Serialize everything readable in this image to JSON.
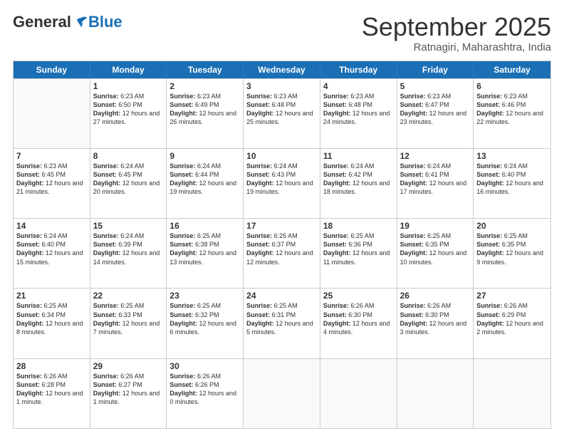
{
  "header": {
    "logo_general": "General",
    "logo_blue": "Blue",
    "month_title": "September 2025",
    "location": "Ratnagiri, Maharashtra, India"
  },
  "weekdays": [
    "Sunday",
    "Monday",
    "Tuesday",
    "Wednesday",
    "Thursday",
    "Friday",
    "Saturday"
  ],
  "rows": [
    [
      {
        "day": "",
        "sunrise": "",
        "sunset": "",
        "daylight": ""
      },
      {
        "day": "1",
        "sunrise": "6:23 AM",
        "sunset": "6:50 PM",
        "daylight": "12 hours and 27 minutes."
      },
      {
        "day": "2",
        "sunrise": "6:23 AM",
        "sunset": "6:49 PM",
        "daylight": "12 hours and 26 minutes."
      },
      {
        "day": "3",
        "sunrise": "6:23 AM",
        "sunset": "6:48 PM",
        "daylight": "12 hours and 25 minutes."
      },
      {
        "day": "4",
        "sunrise": "6:23 AM",
        "sunset": "6:48 PM",
        "daylight": "12 hours and 24 minutes."
      },
      {
        "day": "5",
        "sunrise": "6:23 AM",
        "sunset": "6:47 PM",
        "daylight": "12 hours and 23 minutes."
      },
      {
        "day": "6",
        "sunrise": "6:23 AM",
        "sunset": "6:46 PM",
        "daylight": "12 hours and 22 minutes."
      }
    ],
    [
      {
        "day": "7",
        "sunrise": "6:23 AM",
        "sunset": "6:45 PM",
        "daylight": "12 hours and 21 minutes."
      },
      {
        "day": "8",
        "sunrise": "6:24 AM",
        "sunset": "6:45 PM",
        "daylight": "12 hours and 20 minutes."
      },
      {
        "day": "9",
        "sunrise": "6:24 AM",
        "sunset": "6:44 PM",
        "daylight": "12 hours and 19 minutes."
      },
      {
        "day": "10",
        "sunrise": "6:24 AM",
        "sunset": "6:43 PM",
        "daylight": "12 hours and 19 minutes."
      },
      {
        "day": "11",
        "sunrise": "6:24 AM",
        "sunset": "6:42 PM",
        "daylight": "12 hours and 18 minutes."
      },
      {
        "day": "12",
        "sunrise": "6:24 AM",
        "sunset": "6:41 PM",
        "daylight": "12 hours and 17 minutes."
      },
      {
        "day": "13",
        "sunrise": "6:24 AM",
        "sunset": "6:40 PM",
        "daylight": "12 hours and 16 minutes."
      }
    ],
    [
      {
        "day": "14",
        "sunrise": "6:24 AM",
        "sunset": "6:40 PM",
        "daylight": "12 hours and 15 minutes."
      },
      {
        "day": "15",
        "sunrise": "6:24 AM",
        "sunset": "6:39 PM",
        "daylight": "12 hours and 14 minutes."
      },
      {
        "day": "16",
        "sunrise": "6:25 AM",
        "sunset": "6:38 PM",
        "daylight": "12 hours and 13 minutes."
      },
      {
        "day": "17",
        "sunrise": "6:25 AM",
        "sunset": "6:37 PM",
        "daylight": "12 hours and 12 minutes."
      },
      {
        "day": "18",
        "sunrise": "6:25 AM",
        "sunset": "6:36 PM",
        "daylight": "12 hours and 11 minutes."
      },
      {
        "day": "19",
        "sunrise": "6:25 AM",
        "sunset": "6:35 PM",
        "daylight": "12 hours and 10 minutes."
      },
      {
        "day": "20",
        "sunrise": "6:25 AM",
        "sunset": "6:35 PM",
        "daylight": "12 hours and 9 minutes."
      }
    ],
    [
      {
        "day": "21",
        "sunrise": "6:25 AM",
        "sunset": "6:34 PM",
        "daylight": "12 hours and 8 minutes."
      },
      {
        "day": "22",
        "sunrise": "6:25 AM",
        "sunset": "6:33 PM",
        "daylight": "12 hours and 7 minutes."
      },
      {
        "day": "23",
        "sunrise": "6:25 AM",
        "sunset": "6:32 PM",
        "daylight": "12 hours and 6 minutes."
      },
      {
        "day": "24",
        "sunrise": "6:25 AM",
        "sunset": "6:31 PM",
        "daylight": "12 hours and 5 minutes."
      },
      {
        "day": "25",
        "sunrise": "6:26 AM",
        "sunset": "6:30 PM",
        "daylight": "12 hours and 4 minutes."
      },
      {
        "day": "26",
        "sunrise": "6:26 AM",
        "sunset": "6:30 PM",
        "daylight": "12 hours and 3 minutes."
      },
      {
        "day": "27",
        "sunrise": "6:26 AM",
        "sunset": "6:29 PM",
        "daylight": "12 hours and 2 minutes."
      }
    ],
    [
      {
        "day": "28",
        "sunrise": "6:26 AM",
        "sunset": "6:28 PM",
        "daylight": "12 hours and 1 minute."
      },
      {
        "day": "29",
        "sunrise": "6:26 AM",
        "sunset": "6:27 PM",
        "daylight": "12 hours and 1 minute."
      },
      {
        "day": "30",
        "sunrise": "6:26 AM",
        "sunset": "6:26 PM",
        "daylight": "12 hours and 0 minutes."
      },
      {
        "day": "",
        "sunrise": "",
        "sunset": "",
        "daylight": ""
      },
      {
        "day": "",
        "sunrise": "",
        "sunset": "",
        "daylight": ""
      },
      {
        "day": "",
        "sunrise": "",
        "sunset": "",
        "daylight": ""
      },
      {
        "day": "",
        "sunrise": "",
        "sunset": "",
        "daylight": ""
      }
    ]
  ]
}
